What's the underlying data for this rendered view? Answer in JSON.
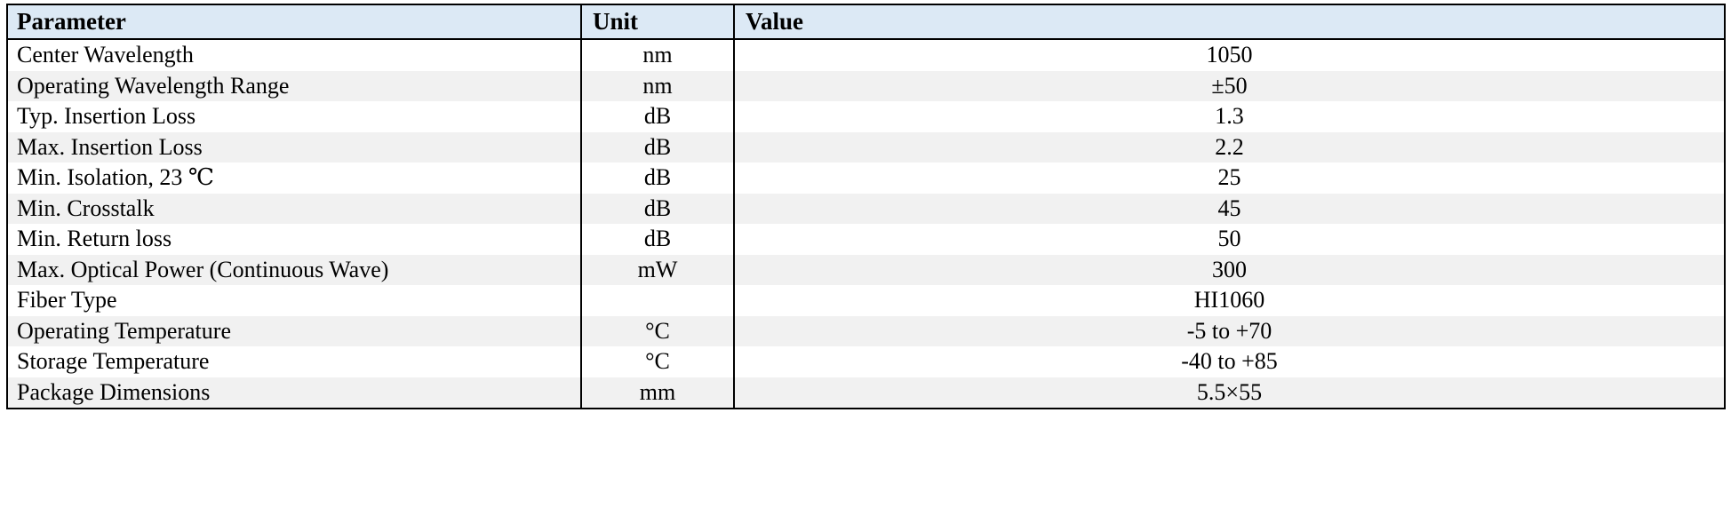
{
  "table": {
    "name": "optical-component-specifications",
    "columns": [
      {
        "key": "parameter",
        "label": "Parameter",
        "align": "left"
      },
      {
        "key": "unit",
        "label": "Unit",
        "align": "center"
      },
      {
        "key": "value",
        "label": "Value",
        "align": "center"
      }
    ],
    "header_background": "#dce9f5",
    "row_background_odd": "#ffffff",
    "row_background_even": "#f1f1f1",
    "border_color": "#000000",
    "rows": [
      {
        "parameter": "Center Wavelength",
        "unit": "nm",
        "value": "1050"
      },
      {
        "parameter": "Operating Wavelength Range",
        "unit": "nm",
        "value": "±50"
      },
      {
        "parameter": "Typ. Insertion Loss",
        "unit": "dB",
        "value": "1.3"
      },
      {
        "parameter": "Max. Insertion Loss",
        "unit": "dB",
        "value": "2.2"
      },
      {
        "parameter": "Min. Isolation, 23 ℃",
        "unit": "dB",
        "value": "25"
      },
      {
        "parameter": "Min. Crosstalk",
        "unit": "dB",
        "value": "45"
      },
      {
        "parameter": "Min. Return loss",
        "unit": "dB",
        "value": "50"
      },
      {
        "parameter": "Max. Optical Power (Continuous Wave)",
        "unit": "mW",
        "value": "300"
      },
      {
        "parameter": "Fiber Type",
        "unit": "",
        "value": "HI1060"
      },
      {
        "parameter": "Operating Temperature",
        "unit": "°C",
        "value": "-5 to +70"
      },
      {
        "parameter": "Storage Temperature",
        "unit": "°C",
        "value": "-40 to +85"
      },
      {
        "parameter": "Package Dimensions",
        "unit": "mm",
        "value": "5.5×55"
      }
    ]
  }
}
